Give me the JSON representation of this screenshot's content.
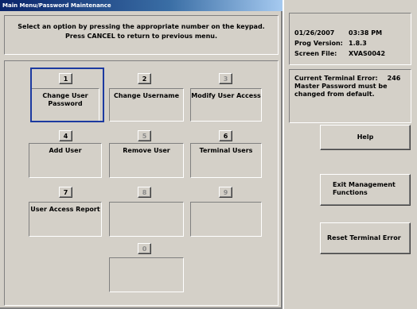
{
  "window": {
    "title": "Main Menu/Password Maintenance"
  },
  "instructions": {
    "line1": "Select an option by pressing the appropriate number on the keypad.",
    "line2": "Press CANCEL to return to previous menu."
  },
  "options": [
    {
      "key": "1",
      "label": "Change User Password",
      "enabled": true,
      "selected": true
    },
    {
      "key": "2",
      "label": "Change Username",
      "enabled": true
    },
    {
      "key": "3",
      "label": "Modify User Access",
      "enabled": true
    },
    {
      "key": "4",
      "label": "Add User",
      "enabled": true
    },
    {
      "key": "5",
      "label": "Remove User",
      "enabled": true
    },
    {
      "key": "6",
      "label": "Terminal Users",
      "enabled": true
    },
    {
      "key": "7",
      "label": "User Access Report",
      "enabled": true
    },
    {
      "key": "8",
      "label": "",
      "enabled": false
    },
    {
      "key": "9",
      "label": "",
      "enabled": false
    },
    {
      "key": "0",
      "label": "",
      "enabled": false
    }
  ],
  "status": {
    "date": "01/26/2007",
    "time": "03:38 PM",
    "prog_version_label": "Prog Version:",
    "prog_version": "1.8.3",
    "screen_file_label": "Screen File:",
    "screen_file": "XVAS0042"
  },
  "error": {
    "label": "Current Terminal Error:",
    "code": "246",
    "message": "Master Password must be changed from default."
  },
  "buttons": {
    "help": "Help",
    "exit_line1": "Exit Management",
    "exit_line2": "Functions",
    "reset": "Reset Terminal Error"
  }
}
